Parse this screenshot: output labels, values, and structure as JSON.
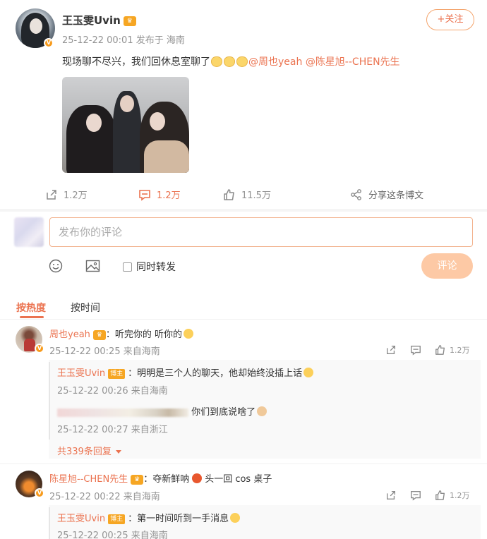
{
  "post": {
    "author": "王玉雯Uvin",
    "meta": "25-12-22 00:01 发布于 海南",
    "follow_label": "+关注",
    "text_before_mentions": "现场聊不尽兴，我们回休息室聊了",
    "mention1": "@周也yeah",
    "mention2": "@陈星旭--CHEN先生",
    "reposts": "1.2万",
    "comments": "1.2万",
    "likes": "11.5万",
    "share_label": "分享这条博文"
  },
  "composer": {
    "placeholder": "发布你的评论",
    "repost_checkbox_label": "同时转发",
    "submit_label": "评论"
  },
  "sort": {
    "hot_label": "按热度",
    "time_label": "按时间"
  },
  "comments": [
    {
      "user": "周也yeah",
      "text": "：听完你的 听你的",
      "meta": "25-12-22 00:25 来自海南",
      "likes": "1.2万",
      "replies": [
        {
          "user": "王玉雯Uvin",
          "badge": "博主",
          "text": "：明明是三个人的聊天，他却始终没插上话",
          "meta": "25-12-22 00:26 来自海南"
        },
        {
          "user": "",
          "text": "你们到底说啥了",
          "meta": "25-12-22 00:27 来自浙江"
        }
      ],
      "more_replies": "共339条回复"
    },
    {
      "user": "陈星旭--CHEN先生",
      "text": "：夺新鲜呐",
      "text2": "头一回 cos 桌子",
      "meta": "25-12-22 00:22 来自海南",
      "likes": "1.2万",
      "replies": [
        {
          "user": "王玉雯Uvin",
          "badge": "博主",
          "text": "：第一时间听到一手消息",
          "meta": "25-12-22 00:25 来自海南"
        }
      ]
    }
  ],
  "colors": {
    "accent": "#eb7350",
    "meta_grey": "#939393",
    "submit_disabled": "#fdc9a5"
  },
  "icons": [
    "repost-icon",
    "comment-icon",
    "like-icon",
    "share-icon",
    "emoji-icon",
    "image-icon",
    "dropdown-caret-icon"
  ]
}
